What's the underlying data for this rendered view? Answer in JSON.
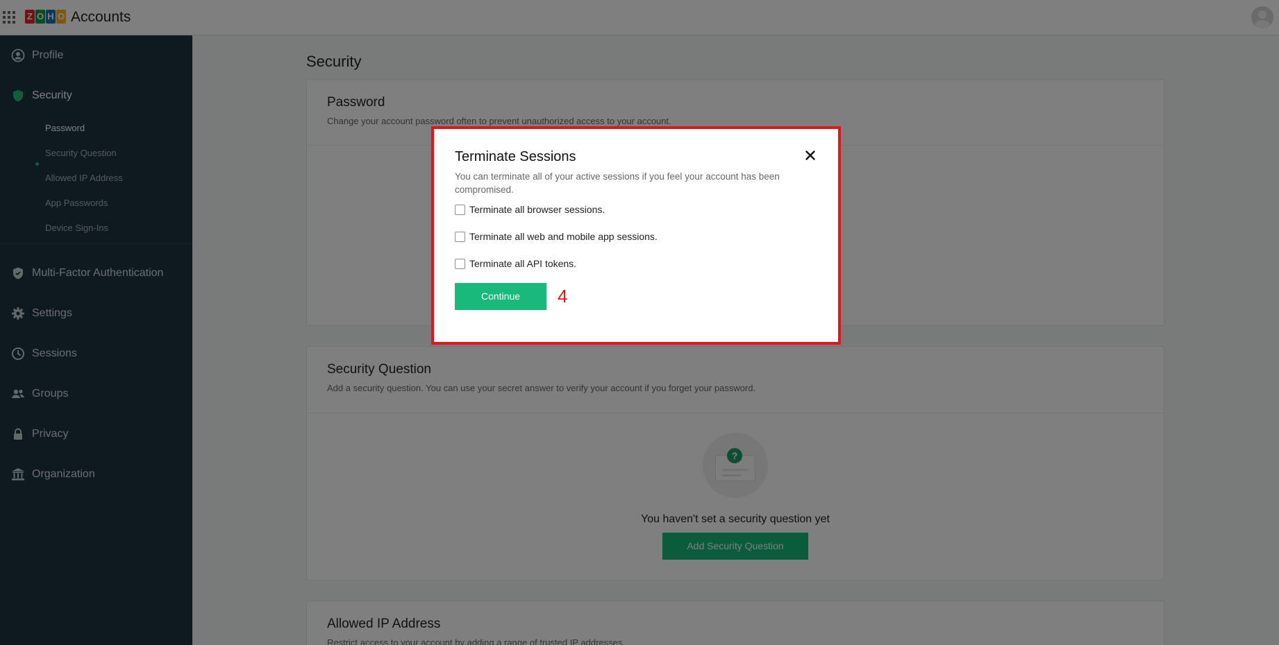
{
  "header": {
    "app_title": "Accounts",
    "logo_letters": [
      "Z",
      "O",
      "H",
      "O"
    ],
    "logo_colors": [
      "#e42527",
      "#089949",
      "#226db4",
      "#f9b21d"
    ]
  },
  "sidebar": {
    "items": [
      {
        "label": "Profile",
        "icon": "profile-icon"
      },
      {
        "label": "Security",
        "icon": "shield-icon"
      },
      {
        "label": "Multi-Factor Authentication",
        "icon": "mfa-shield-icon"
      },
      {
        "label": "Settings",
        "icon": "gear-icon"
      },
      {
        "label": "Sessions",
        "icon": "clock-icon"
      },
      {
        "label": "Groups",
        "icon": "users-icon"
      },
      {
        "label": "Privacy",
        "icon": "lock-icon"
      },
      {
        "label": "Organization",
        "icon": "building-icon"
      }
    ],
    "security_subitems": [
      "Password",
      "Security Question",
      "Allowed IP Address",
      "App Passwords",
      "Device Sign-Ins"
    ]
  },
  "main": {
    "title": "Security",
    "password_card": {
      "title": "Password",
      "description": "Change your account password often to prevent unauthorized access to your account."
    },
    "security_question_card": {
      "title": "Security Question",
      "description": "Add a security question. You can use your secret answer to verify your account if you forget your password.",
      "empty_text": "You haven't set a security question yet",
      "button_label": "Add Security Question"
    },
    "allowed_ip_card": {
      "title": "Allowed IP Address",
      "description": "Restrict access to your account by adding a range of trusted IP addresses."
    }
  },
  "modal": {
    "title": "Terminate Sessions",
    "description": "You can terminate all of your active sessions if you feel your account has been compromised.",
    "options": [
      "Terminate all browser sessions.",
      "Terminate all web and mobile app sessions.",
      "Terminate all API tokens."
    ],
    "continue_label": "Continue"
  },
  "annotation": {
    "step_number": "4"
  },
  "colors": {
    "accent_green": "#17b77a",
    "sidebar_bg": "#1e3340",
    "highlight_red": "#e2141c"
  }
}
